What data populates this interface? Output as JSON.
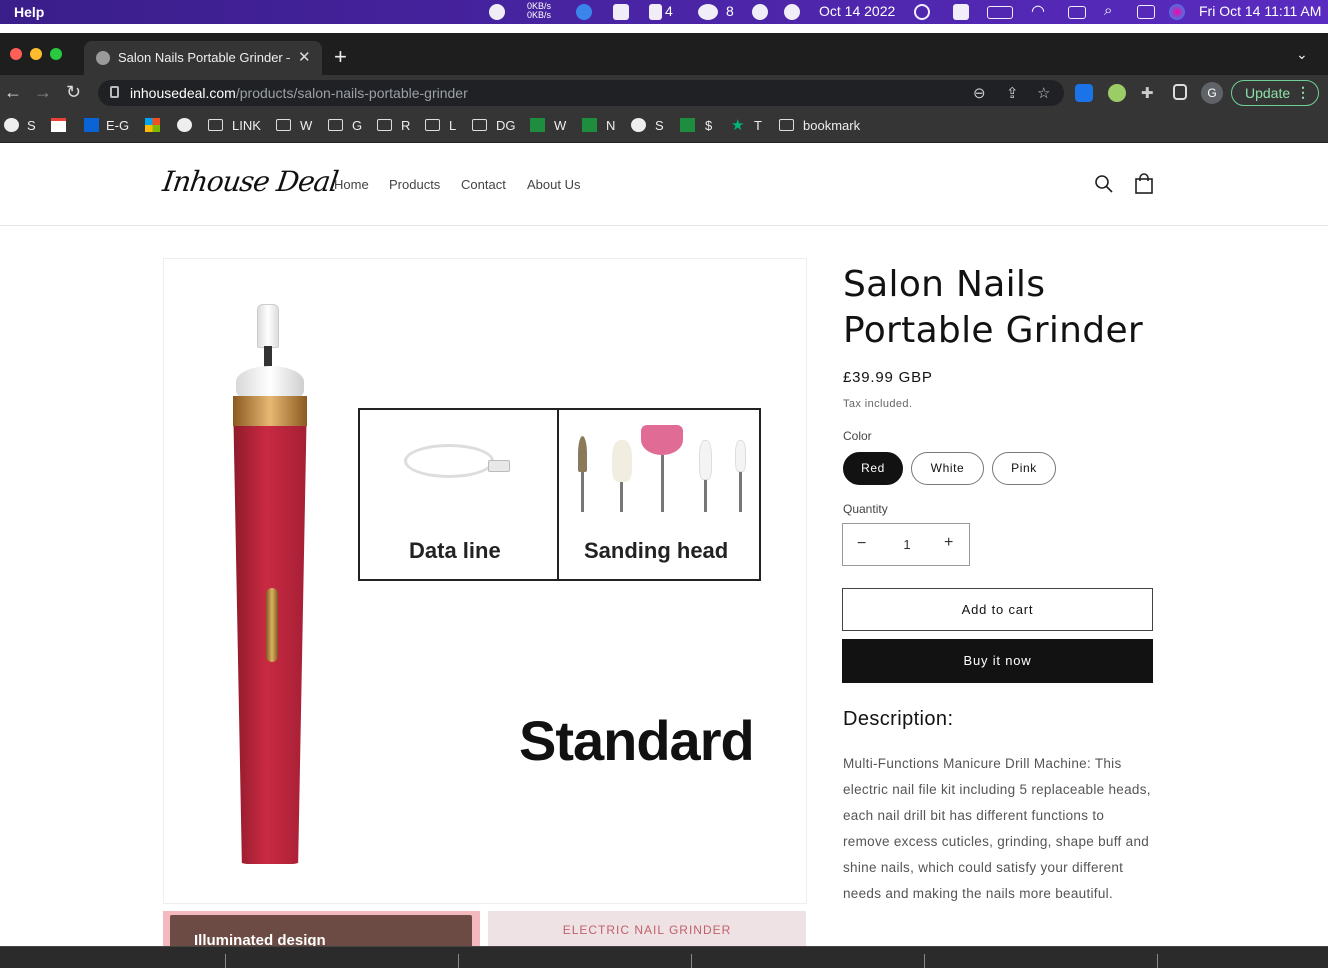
{
  "menubar": {
    "help": "Help",
    "net_up": "0KB/s",
    "net_down": "0KB/s",
    "notifications_count": "4",
    "wechat_count": "8",
    "date_short": "Oct 14 2022",
    "datetime": "Fri Oct 14  11:11 AM"
  },
  "browser": {
    "tab_title": "Salon Nails Portable Grinder – I",
    "url_domain": "inhousedeal.com",
    "url_path": "/products/salon-nails-portable-grinder",
    "profile_initial": "G",
    "update_label": "Update",
    "bookmarks": [
      {
        "label": "S",
        "icon": "globe-icon"
      },
      {
        "label": "",
        "icon": "gmail-icon"
      },
      {
        "label": "E-G",
        "icon": "outlook-icon"
      },
      {
        "label": "",
        "icon": "microsoft-icon"
      },
      {
        "label": "",
        "icon": "globe-icon"
      },
      {
        "label": "LINK",
        "icon": "folder-icon"
      },
      {
        "label": "W",
        "icon": "folder-icon"
      },
      {
        "label": "G",
        "icon": "folder-icon"
      },
      {
        "label": "R",
        "icon": "folder-icon"
      },
      {
        "label": "L",
        "icon": "folder-icon"
      },
      {
        "label": "DG",
        "icon": "folder-icon"
      },
      {
        "label": "W",
        "icon": "sheets-icon"
      },
      {
        "label": "N",
        "icon": "sheets-icon"
      },
      {
        "label": "S",
        "icon": "globe-icon"
      },
      {
        "label": "$",
        "icon": "sheets-icon"
      },
      {
        "label": "T",
        "icon": "star-icon"
      },
      {
        "label": "bookmark",
        "icon": "folder-icon"
      }
    ]
  },
  "site": {
    "logo": "Inhouse Deal",
    "nav": [
      "Home",
      "Products",
      "Contact",
      "About Us"
    ],
    "image": {
      "box_left": "Data line",
      "box_right": "Sanding head",
      "caption": "Standard"
    },
    "thumbnails": [
      "Illuminated design",
      "ELECTRIC NAIL GRINDER"
    ],
    "product": {
      "title": "Salon Nails Portable Grinder",
      "price": "£39.99 GBP",
      "tax_note": "Tax included.",
      "color_label": "Color",
      "colors": [
        "Red",
        "White",
        "Pink"
      ],
      "selected_color": "Red",
      "quantity_label": "Quantity",
      "quantity": "1",
      "minus": "−",
      "plus": "+",
      "add_to_cart": "Add to cart",
      "buy_now": "Buy it now",
      "description_heading": "Description:",
      "description": "Multi-Functions Manicure Drill Machine: This electric nail file kit including 5 replaceable heads, each nail drill bit has different functions to remove excess cuticles, grinding, shape buff and shine nails, which could satisfy your different needs and making the nails more beautiful."
    }
  },
  "colors": {
    "menubar_bg": "#4a25a8",
    "browser_dark": "#353535",
    "update_green": "#8de0a8",
    "button_dark": "#121212",
    "product_red": "#c92a42"
  }
}
